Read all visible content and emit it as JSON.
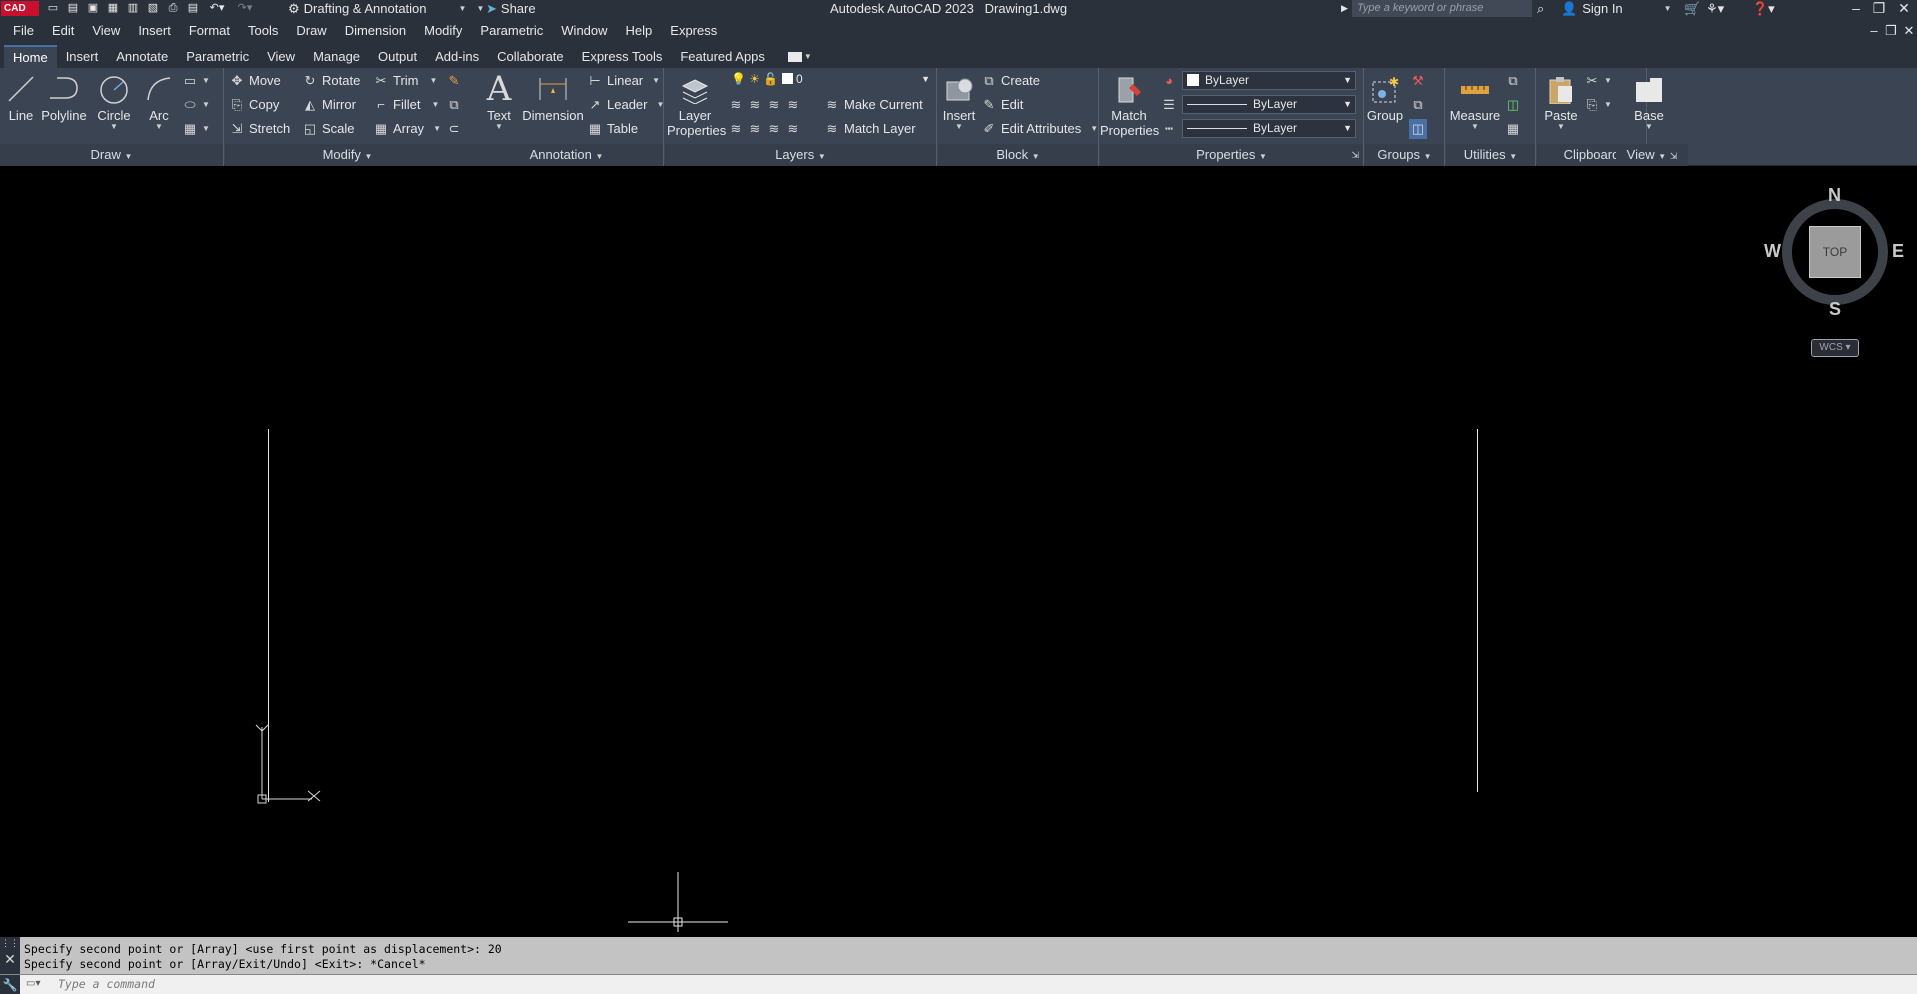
{
  "titlebar": {
    "logo": "CAD",
    "workspace": "Drafting & Annotation",
    "share": "Share",
    "app_title": "Autodesk AutoCAD 2023",
    "doc_name": "Drawing1.dwg",
    "search_placeholder": "Type a keyword or phrase",
    "sign_in": "Sign In"
  },
  "menu": [
    "File",
    "Edit",
    "View",
    "Insert",
    "Format",
    "Tools",
    "Draw",
    "Dimension",
    "Modify",
    "Parametric",
    "Window",
    "Help",
    "Express"
  ],
  "tabs": [
    "Home",
    "Insert",
    "Annotate",
    "Parametric",
    "View",
    "Manage",
    "Output",
    "Add-ins",
    "Collaborate",
    "Express Tools",
    "Featured Apps"
  ],
  "ribbon": {
    "draw": {
      "title": "Draw",
      "line": "Line",
      "polyline": "Polyline",
      "circle": "Circle",
      "arc": "Arc"
    },
    "modify": {
      "title": "Modify",
      "move": "Move",
      "rotate": "Rotate",
      "trim": "Trim",
      "copy": "Copy",
      "mirror": "Mirror",
      "fillet": "Fillet",
      "stretch": "Stretch",
      "scale": "Scale",
      "array": "Array"
    },
    "annotation": {
      "title": "Annotation",
      "text": "Text",
      "dimension": "Dimension",
      "linear": "Linear",
      "leader": "Leader",
      "table": "Table"
    },
    "layers": {
      "title": "Layers",
      "layer_properties_1": "Layer",
      "layer_properties_2": "Properties",
      "current_layer": "0",
      "make_current": "Make Current",
      "match_layer": "Match Layer"
    },
    "block": {
      "title": "Block",
      "insert": "Insert",
      "create": "Create",
      "edit": "Edit",
      "edit_attributes": "Edit Attributes"
    },
    "properties": {
      "title": "Properties",
      "match_1": "Match",
      "match_2": "Properties",
      "color": "ByLayer",
      "lineweight": "ByLayer",
      "linetype": "ByLayer"
    },
    "groups": {
      "title": "Groups",
      "group": "Group"
    },
    "utilities": {
      "title": "Utilities",
      "measure": "Measure"
    },
    "clipboard": {
      "title": "Clipboard",
      "paste": "Paste"
    },
    "view": {
      "title": "View",
      "base": "Base"
    }
  },
  "viewcube": {
    "n": "N",
    "s": "S",
    "e": "E",
    "w": "W",
    "face": "TOP",
    "wcs": "WCS"
  },
  "ucs": {
    "x": "X",
    "y": "Y"
  },
  "command": {
    "history": [
      "Specify second point or [Array] <use first point as displacement>: 20",
      "Specify second point or [Array/Exit/Undo] <Exit>: *Cancel*"
    ],
    "placeholder": "Type a command"
  }
}
